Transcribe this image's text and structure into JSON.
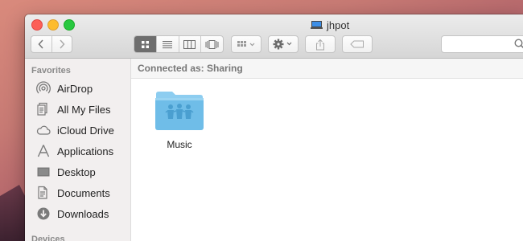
{
  "window": {
    "title": "jhpot",
    "title_icon": "network-computer-icon"
  },
  "toolbar": {
    "back_icon": "chevron-left-icon",
    "forward_icon": "chevron-right-icon",
    "view_modes": [
      "icon-view",
      "list-view",
      "column-view",
      "cover-flow-view"
    ],
    "active_view": "icon-view",
    "arrange_icon": "arrange-grid-icon",
    "action_icon": "gear-icon",
    "share_icon": "share-icon",
    "tag_icon": "tag-icon",
    "search_value": "",
    "search_icon": "search-icon"
  },
  "sidebar": {
    "favorites_heading": "Favorites",
    "items": [
      {
        "label": "AirDrop",
        "icon": "airdrop-icon"
      },
      {
        "label": "All My Files",
        "icon": "all-files-icon"
      },
      {
        "label": "iCloud Drive",
        "icon": "cloud-icon"
      },
      {
        "label": "Applications",
        "icon": "applications-icon"
      },
      {
        "label": "Desktop",
        "icon": "desktop-icon"
      },
      {
        "label": "Documents",
        "icon": "documents-icon"
      },
      {
        "label": "Downloads",
        "icon": "downloads-icon"
      }
    ],
    "devices_heading": "Devices"
  },
  "content": {
    "path_text": "Connected as: Sharing",
    "files": [
      {
        "name": "Music",
        "icon": "shared-folder-icon"
      }
    ]
  },
  "colors": {
    "folder_blue": "#6fbde8",
    "folder_tab": "#8dcdf0",
    "sidebar_icon": "#7a7a7a",
    "active_segment": "#6e6e6e"
  }
}
